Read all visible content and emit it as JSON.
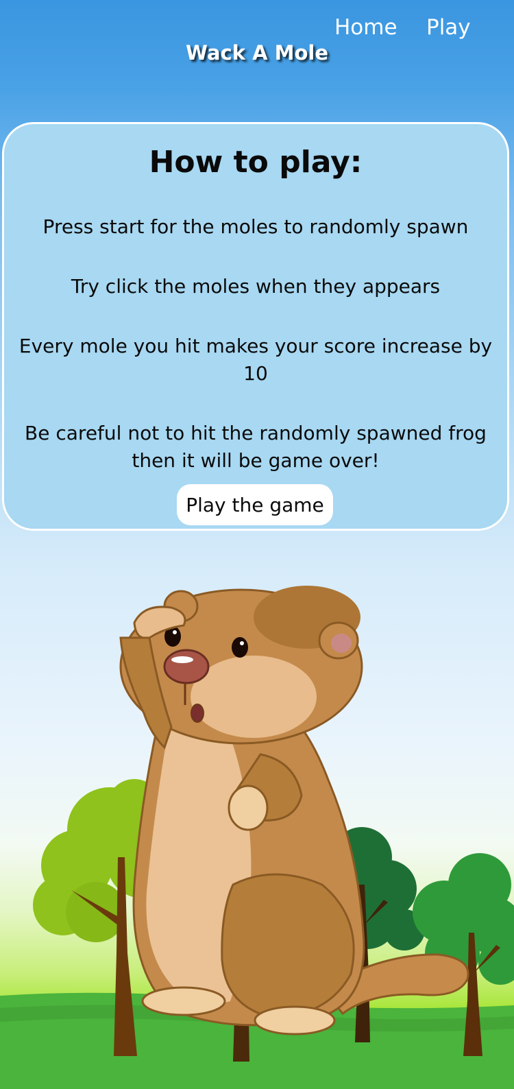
{
  "nav": {
    "home_label": "Home",
    "play_label": "Play"
  },
  "site": {
    "title": "Wack A Mole"
  },
  "instructions": {
    "heading": "How to play:",
    "rules": [
      "Press start for the moles to randomly spawn",
      "Try click the moles when they appears",
      "Every mole you hit makes your score increase by 10",
      "Be careful not to hit the randomly spawned frog then it will be game over!"
    ],
    "play_button_label": "Play the game"
  },
  "colors": {
    "header_blue": "#3a96e0",
    "card_background": "#a8d8f2",
    "grass_green": "#4ab43c",
    "mole_fur": "#c48a4c"
  },
  "illustration": {
    "subject": "cartoon groundhog standing among trees on grass"
  }
}
